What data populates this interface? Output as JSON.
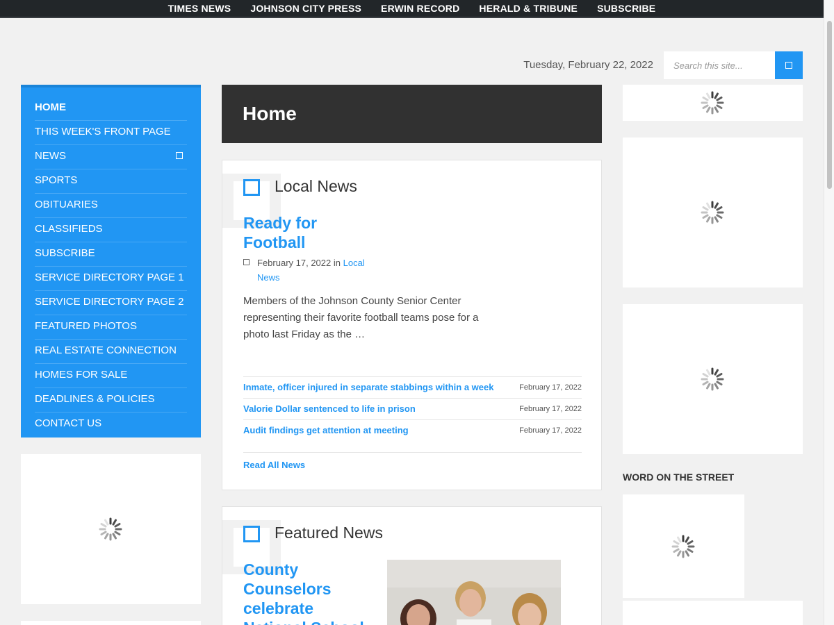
{
  "topnav": [
    "TIMES NEWS",
    "JOHNSON CITY PRESS",
    "ERWIN RECORD",
    "HERALD & TRIBUNE",
    "SUBSCRIBE"
  ],
  "header": {
    "date": "Tuesday, February 22, 2022",
    "search_placeholder": "Search this site..."
  },
  "sidebar": {
    "items": [
      {
        "label": "HOME"
      },
      {
        "label": "THIS WEEK'S FRONT PAGE"
      },
      {
        "label": "NEWS"
      },
      {
        "label": "SPORTS"
      },
      {
        "label": "OBITUARIES"
      },
      {
        "label": "CLASSIFIEDS"
      },
      {
        "label": "SUBSCRIBE"
      },
      {
        "label": "SERVICE DIRECTORY PAGE 1"
      },
      {
        "label": "SERVICE DIRECTORY PAGE 2"
      },
      {
        "label": "FEATURED PHOTOS"
      },
      {
        "label": "REAL ESTATE CONNECTION"
      },
      {
        "label": "HOMES FOR SALE"
      },
      {
        "label": "DEADLINES & POLICIES"
      },
      {
        "label": "CONTACT US"
      }
    ]
  },
  "page_title": "Home",
  "local_news": {
    "heading": "Local News",
    "feature": {
      "title": "Ready for Football",
      "date": "February 17, 2022",
      "in_text": "in",
      "category": "Local News",
      "excerpt": "Members of the Johnson County Senior Center representing their favorite football teams pose for a photo last Friday as the …"
    },
    "headlines": [
      {
        "title": "Inmate, officer injured in separate stabbings within a week",
        "date": "February 17, 2022"
      },
      {
        "title": "Valorie Dollar sentenced to life in prison",
        "date": "February 17, 2022"
      },
      {
        "title": "Audit findings get attention at meeting",
        "date": "February 17, 2022"
      }
    ],
    "read_all": "Read All News"
  },
  "featured_news": {
    "heading": "Featured News",
    "feature_title": "County Counselors celebrate National School"
  },
  "right_sidebar": {
    "section_label": "WORD ON THE STREET"
  },
  "colors": {
    "accent": "#2196f3",
    "topbar": "#222629",
    "title_bar": "#313131"
  }
}
